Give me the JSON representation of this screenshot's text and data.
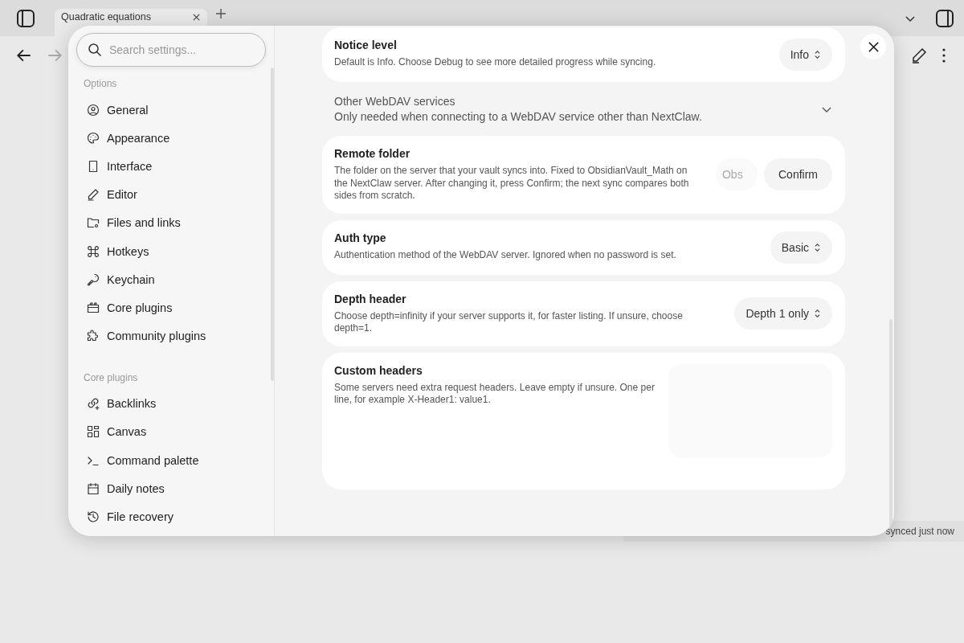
{
  "app": {
    "tab": {
      "title": "Quadratic equations"
    },
    "status_bar": "synced just now"
  },
  "settings": {
    "search": {
      "placeholder": "Search settings..."
    },
    "sidebar": [
      {
        "heading": "Options",
        "items": [
          {
            "label": "General",
            "selected": false
          },
          {
            "label": "Appearance",
            "selected": false
          },
          {
            "label": "Interface",
            "selected": false
          },
          {
            "label": "Editor",
            "selected": false
          },
          {
            "label": "Files and links",
            "selected": false
          },
          {
            "label": "Hotkeys",
            "selected": false
          },
          {
            "label": "Keychain",
            "selected": false
          },
          {
            "label": "Core plugins",
            "selected": false
          },
          {
            "label": "Community plugins",
            "selected": false
          }
        ]
      },
      {
        "heading": "Core plugins",
        "items": [
          {
            "label": "Backlinks",
            "selected": false
          },
          {
            "label": "Canvas",
            "selected": false
          },
          {
            "label": "Command palette",
            "selected": false
          },
          {
            "label": "Daily notes",
            "selected": false
          },
          {
            "label": "File recovery",
            "selected": false
          }
        ]
      }
    ],
    "rows": [
      {
        "kind": "select",
        "title": "Notice level",
        "description": "Default is Info. Choose Debug to see more detailed progress while syncing.",
        "value": "Info"
      },
      {
        "kind": "group",
        "title": "Other WebDAV services",
        "description": "Only needed when connecting to a WebDAV service other than NextClaw.",
        "expanded": false
      },
      {
        "kind": "text-confirm",
        "title": "Remote folder",
        "description": "The folder on the server that your vault syncs into. Fixed to ObsidianVault_Math on the NextClaw server. After changing it, press Confirm; the next sync compares both sides from scratch.",
        "placeholder": "Obs",
        "button": "Confirm"
      },
      {
        "kind": "select",
        "title": "Auth type",
        "description": "Authentication method of the WebDAV server. Ignored when no password is set.",
        "value": "Basic"
      },
      {
        "kind": "select",
        "title": "Depth header",
        "description": "Choose depth=infinity if your server supports it, for faster listing. If unsure, choose depth=1.",
        "value": "Depth 1 only"
      },
      {
        "kind": "textarea",
        "title": "Custom headers",
        "description": "Some servers need extra request headers. Leave empty if unsure. One per line, for example X-Header1: value1."
      }
    ]
  }
}
